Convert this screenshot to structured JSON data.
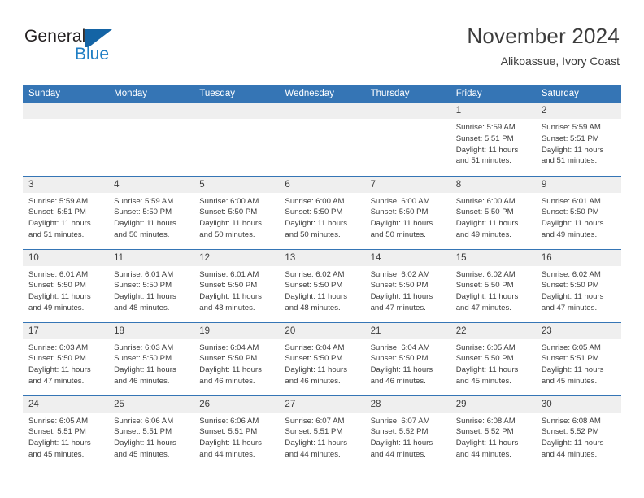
{
  "brand": {
    "name_part1": "General",
    "name_part2": "Blue",
    "accent_color": "#1464a5",
    "blue_text_color": "#1f7ec4"
  },
  "header": {
    "title": "November 2024",
    "subtitle": "Alikoassue, Ivory Coast"
  },
  "theme": {
    "header_row_bg": "#3575b5",
    "daynum_bg": "#efefef",
    "row_divider": "#3575b5",
    "text": "#3c3c3c"
  },
  "weekday_headers": [
    "Sunday",
    "Monday",
    "Tuesday",
    "Wednesday",
    "Thursday",
    "Friday",
    "Saturday"
  ],
  "weeks": [
    [
      {
        "day": "",
        "blank": true,
        "sunrise": "",
        "sunset": "",
        "daylight1": "",
        "daylight2": ""
      },
      {
        "day": "",
        "blank": true,
        "sunrise": "",
        "sunset": "",
        "daylight1": "",
        "daylight2": ""
      },
      {
        "day": "",
        "blank": true,
        "sunrise": "",
        "sunset": "",
        "daylight1": "",
        "daylight2": ""
      },
      {
        "day": "",
        "blank": true,
        "sunrise": "",
        "sunset": "",
        "daylight1": "",
        "daylight2": ""
      },
      {
        "day": "",
        "blank": true,
        "sunrise": "",
        "sunset": "",
        "daylight1": "",
        "daylight2": ""
      },
      {
        "day": "1",
        "sunrise": "Sunrise: 5:59 AM",
        "sunset": "Sunset: 5:51 PM",
        "daylight1": "Daylight: 11 hours",
        "daylight2": "and 51 minutes."
      },
      {
        "day": "2",
        "sunrise": "Sunrise: 5:59 AM",
        "sunset": "Sunset: 5:51 PM",
        "daylight1": "Daylight: 11 hours",
        "daylight2": "and 51 minutes."
      }
    ],
    [
      {
        "day": "3",
        "sunrise": "Sunrise: 5:59 AM",
        "sunset": "Sunset: 5:51 PM",
        "daylight1": "Daylight: 11 hours",
        "daylight2": "and 51 minutes."
      },
      {
        "day": "4",
        "sunrise": "Sunrise: 5:59 AM",
        "sunset": "Sunset: 5:50 PM",
        "daylight1": "Daylight: 11 hours",
        "daylight2": "and 50 minutes."
      },
      {
        "day": "5",
        "sunrise": "Sunrise: 6:00 AM",
        "sunset": "Sunset: 5:50 PM",
        "daylight1": "Daylight: 11 hours",
        "daylight2": "and 50 minutes."
      },
      {
        "day": "6",
        "sunrise": "Sunrise: 6:00 AM",
        "sunset": "Sunset: 5:50 PM",
        "daylight1": "Daylight: 11 hours",
        "daylight2": "and 50 minutes."
      },
      {
        "day": "7",
        "sunrise": "Sunrise: 6:00 AM",
        "sunset": "Sunset: 5:50 PM",
        "daylight1": "Daylight: 11 hours",
        "daylight2": "and 50 minutes."
      },
      {
        "day": "8",
        "sunrise": "Sunrise: 6:00 AM",
        "sunset": "Sunset: 5:50 PM",
        "daylight1": "Daylight: 11 hours",
        "daylight2": "and 49 minutes."
      },
      {
        "day": "9",
        "sunrise": "Sunrise: 6:01 AM",
        "sunset": "Sunset: 5:50 PM",
        "daylight1": "Daylight: 11 hours",
        "daylight2": "and 49 minutes."
      }
    ],
    [
      {
        "day": "10",
        "sunrise": "Sunrise: 6:01 AM",
        "sunset": "Sunset: 5:50 PM",
        "daylight1": "Daylight: 11 hours",
        "daylight2": "and 49 minutes."
      },
      {
        "day": "11",
        "sunrise": "Sunrise: 6:01 AM",
        "sunset": "Sunset: 5:50 PM",
        "daylight1": "Daylight: 11 hours",
        "daylight2": "and 48 minutes."
      },
      {
        "day": "12",
        "sunrise": "Sunrise: 6:01 AM",
        "sunset": "Sunset: 5:50 PM",
        "daylight1": "Daylight: 11 hours",
        "daylight2": "and 48 minutes."
      },
      {
        "day": "13",
        "sunrise": "Sunrise: 6:02 AM",
        "sunset": "Sunset: 5:50 PM",
        "daylight1": "Daylight: 11 hours",
        "daylight2": "and 48 minutes."
      },
      {
        "day": "14",
        "sunrise": "Sunrise: 6:02 AM",
        "sunset": "Sunset: 5:50 PM",
        "daylight1": "Daylight: 11 hours",
        "daylight2": "and 47 minutes."
      },
      {
        "day": "15",
        "sunrise": "Sunrise: 6:02 AM",
        "sunset": "Sunset: 5:50 PM",
        "daylight1": "Daylight: 11 hours",
        "daylight2": "and 47 minutes."
      },
      {
        "day": "16",
        "sunrise": "Sunrise: 6:02 AM",
        "sunset": "Sunset: 5:50 PM",
        "daylight1": "Daylight: 11 hours",
        "daylight2": "and 47 minutes."
      }
    ],
    [
      {
        "day": "17",
        "sunrise": "Sunrise: 6:03 AM",
        "sunset": "Sunset: 5:50 PM",
        "daylight1": "Daylight: 11 hours",
        "daylight2": "and 47 minutes."
      },
      {
        "day": "18",
        "sunrise": "Sunrise: 6:03 AM",
        "sunset": "Sunset: 5:50 PM",
        "daylight1": "Daylight: 11 hours",
        "daylight2": "and 46 minutes."
      },
      {
        "day": "19",
        "sunrise": "Sunrise: 6:04 AM",
        "sunset": "Sunset: 5:50 PM",
        "daylight1": "Daylight: 11 hours",
        "daylight2": "and 46 minutes."
      },
      {
        "day": "20",
        "sunrise": "Sunrise: 6:04 AM",
        "sunset": "Sunset: 5:50 PM",
        "daylight1": "Daylight: 11 hours",
        "daylight2": "and 46 minutes."
      },
      {
        "day": "21",
        "sunrise": "Sunrise: 6:04 AM",
        "sunset": "Sunset: 5:50 PM",
        "daylight1": "Daylight: 11 hours",
        "daylight2": "and 46 minutes."
      },
      {
        "day": "22",
        "sunrise": "Sunrise: 6:05 AM",
        "sunset": "Sunset: 5:50 PM",
        "daylight1": "Daylight: 11 hours",
        "daylight2": "and 45 minutes."
      },
      {
        "day": "23",
        "sunrise": "Sunrise: 6:05 AM",
        "sunset": "Sunset: 5:51 PM",
        "daylight1": "Daylight: 11 hours",
        "daylight2": "and 45 minutes."
      }
    ],
    [
      {
        "day": "24",
        "sunrise": "Sunrise: 6:05 AM",
        "sunset": "Sunset: 5:51 PM",
        "daylight1": "Daylight: 11 hours",
        "daylight2": "and 45 minutes."
      },
      {
        "day": "25",
        "sunrise": "Sunrise: 6:06 AM",
        "sunset": "Sunset: 5:51 PM",
        "daylight1": "Daylight: 11 hours",
        "daylight2": "and 45 minutes."
      },
      {
        "day": "26",
        "sunrise": "Sunrise: 6:06 AM",
        "sunset": "Sunset: 5:51 PM",
        "daylight1": "Daylight: 11 hours",
        "daylight2": "and 44 minutes."
      },
      {
        "day": "27",
        "sunrise": "Sunrise: 6:07 AM",
        "sunset": "Sunset: 5:51 PM",
        "daylight1": "Daylight: 11 hours",
        "daylight2": "and 44 minutes."
      },
      {
        "day": "28",
        "sunrise": "Sunrise: 6:07 AM",
        "sunset": "Sunset: 5:52 PM",
        "daylight1": "Daylight: 11 hours",
        "daylight2": "and 44 minutes."
      },
      {
        "day": "29",
        "sunrise": "Sunrise: 6:08 AM",
        "sunset": "Sunset: 5:52 PM",
        "daylight1": "Daylight: 11 hours",
        "daylight2": "and 44 minutes."
      },
      {
        "day": "30",
        "sunrise": "Sunrise: 6:08 AM",
        "sunset": "Sunset: 5:52 PM",
        "daylight1": "Daylight: 11 hours",
        "daylight2": "and 44 minutes."
      }
    ]
  ]
}
